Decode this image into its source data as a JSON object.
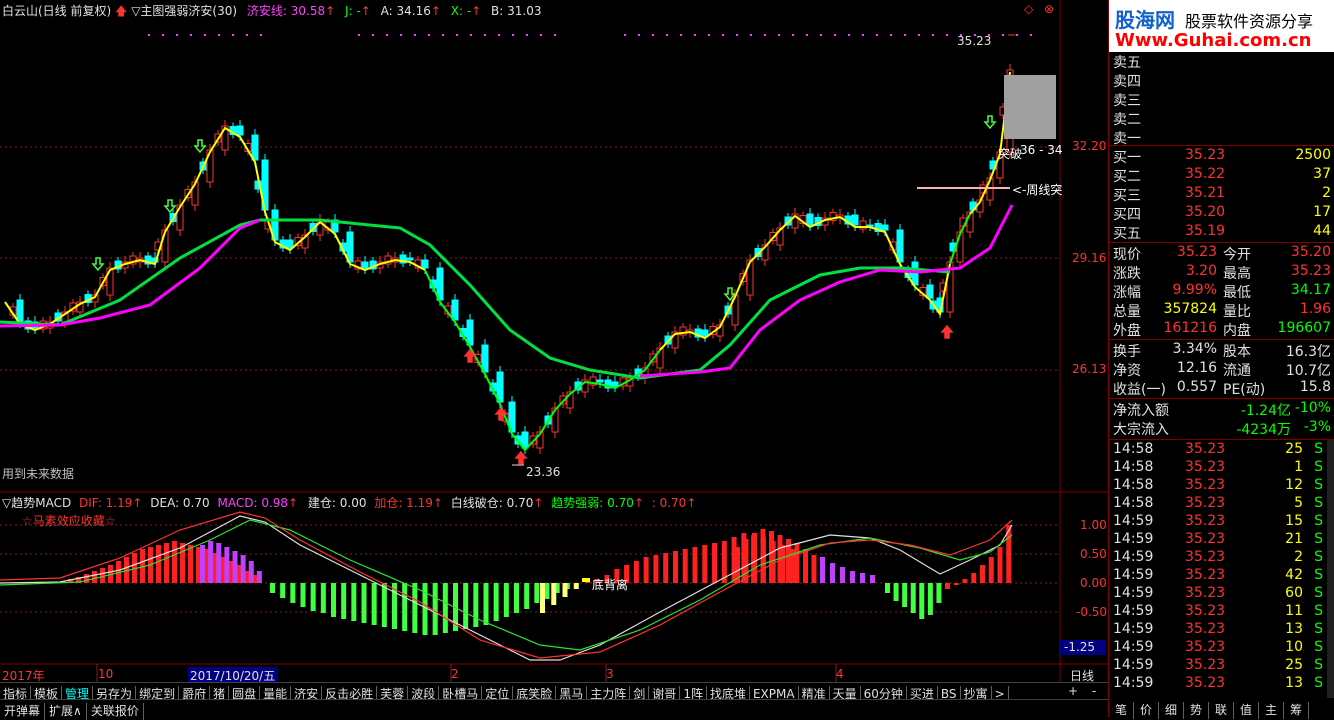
{
  "header": {
    "stock": "白云山(日线 前复权)",
    "indicator": "▽主图强弱济安(30)",
    "jian": "济安线: 30.58",
    "j": "J: -",
    "a": "A: 34.16",
    "x": "X: -",
    "b": "B: 31.03"
  },
  "main_chart": {
    "price_labels": [
      "32.20",
      "29.16",
      "26.13"
    ],
    "high_label": "35.23",
    "low_label": "23.36",
    "annot_breakout": "突破",
    "annot_range": "36 - 34",
    "annot_week": "<-周线突",
    "future_note": "用到未来数据"
  },
  "macd": {
    "title": "▽趋势MACD",
    "dif": "DIF: 1.19",
    "dea": "DEA: 0.70",
    "macd": "MACD: 0.98",
    "jc": "建仓: 0.00",
    "jia": "加仓: 1.19",
    "bai": "白线破仓: 0.70",
    "qs": "趋势强弱: 0.70",
    "colon": ": 0.70",
    "subtitle": "☆马素效应收藏☆",
    "levels": [
      "1.00",
      "0.50",
      "0.00",
      "-0.50"
    ],
    "cursor_value": "-1.25",
    "divergence": "底背离"
  },
  "time_axis": {
    "labels": [
      "2017年",
      "10",
      "2017/10/20/五",
      "2",
      "3",
      "4"
    ],
    "period": "日线"
  },
  "toolbar": {
    "buttons": [
      "指标",
      "模板",
      "管理",
      "另存为",
      "绑定到",
      "爵府",
      "猪",
      "圆盘",
      "量能",
      "济安",
      "反击必胜",
      "芙蓉",
      "波段",
      "卧槽马",
      "定位",
      "底笑脸",
      "黑马",
      "主力阵",
      "剑",
      "谢哥",
      "1阵",
      "找底堆",
      "EXPMA",
      "精准",
      "天量",
      "60分钟",
      "买进",
      "BS",
      "抄寓"
    ],
    "more": ">",
    "plus": "+",
    "minus": "-"
  },
  "bottom": {
    "items": [
      "开弹幕",
      "扩展∧",
      "关联报价"
    ]
  },
  "side": {
    "brand_name": "股海网",
    "brand_slogan": "股票软件资源分享",
    "brand_url": "Www.Guhai.com.cn",
    "sell": [
      {
        "label": "卖五"
      },
      {
        "label": "卖四"
      },
      {
        "label": "卖三"
      },
      {
        "label": "卖二"
      },
      {
        "label": "卖一"
      }
    ],
    "buy": [
      {
        "label": "买一",
        "price": "35.23",
        "vol": "2500"
      },
      {
        "label": "买二",
        "price": "35.22",
        "vol": "37"
      },
      {
        "label": "买三",
        "price": "35.21",
        "vol": "2"
      },
      {
        "label": "买四",
        "price": "35.20",
        "vol": "17"
      },
      {
        "label": "买五",
        "price": "35.19",
        "vol": "44"
      }
    ],
    "stats1": [
      {
        "l1": "现价",
        "v1": "35.23",
        "l2": "今开",
        "v2": "35.20"
      },
      {
        "l1": "涨跌",
        "v1": "3.20",
        "l2": "最高",
        "v2": "35.23"
      },
      {
        "l1": "涨幅",
        "v1": "9.99%",
        "l2": "最低",
        "v2": "34.17"
      },
      {
        "l1": "总量",
        "v1": "357824",
        "l2": "量比",
        "v2": "1.96"
      },
      {
        "l1": "外盘",
        "v1": "161216",
        "l2": "内盘",
        "v2": "196607"
      }
    ],
    "stats2": [
      {
        "l1": "换手",
        "v1": "3.34%",
        "l2": "股本",
        "v2": "16.3亿"
      },
      {
        "l1": "净资",
        "v1": "12.16",
        "l2": "流通",
        "v2": "10.7亿"
      },
      {
        "l1": "收益(一)",
        "v1": "0.557",
        "l2": "PE(动)",
        "v2": "15.8"
      }
    ],
    "flow": [
      {
        "label": "净流入额",
        "v1": "-1.24亿",
        "v2": "-10%"
      },
      {
        "label": "大宗流入",
        "v1": "-4234万",
        "v2": "-3%"
      }
    ],
    "ticks": [
      {
        "t": "14:58",
        "p": "35.23",
        "v": "25",
        "d": "S"
      },
      {
        "t": "14:58",
        "p": "35.23",
        "v": "1",
        "d": "S"
      },
      {
        "t": "14:58",
        "p": "35.23",
        "v": "12",
        "d": "S"
      },
      {
        "t": "14:58",
        "p": "35.23",
        "v": "5",
        "d": "S"
      },
      {
        "t": "14:59",
        "p": "35.23",
        "v": "15",
        "d": "S"
      },
      {
        "t": "14:59",
        "p": "35.23",
        "v": "21",
        "d": "S"
      },
      {
        "t": "14:59",
        "p": "35.23",
        "v": "2",
        "d": "S"
      },
      {
        "t": "14:59",
        "p": "35.23",
        "v": "42",
        "d": "S"
      },
      {
        "t": "14:59",
        "p": "35.23",
        "v": "60",
        "d": "S"
      },
      {
        "t": "14:59",
        "p": "35.23",
        "v": "11",
        "d": "S"
      },
      {
        "t": "14:59",
        "p": "35.23",
        "v": "13",
        "d": "S"
      },
      {
        "t": "14:59",
        "p": "35.23",
        "v": "10",
        "d": "S"
      },
      {
        "t": "14:59",
        "p": "35.23",
        "v": "25",
        "d": "S"
      },
      {
        "t": "14:59",
        "p": "35.23",
        "v": "13",
        "d": "S"
      }
    ],
    "tabs": [
      "笔",
      "价",
      "细",
      "势",
      "联",
      "值",
      "主",
      "筹"
    ]
  },
  "colors": {
    "up": "#ff3232",
    "down": "#00ffff",
    "yellow": "#ffff00",
    "green": "#00ff00",
    "magenta": "#ff00ff",
    "purple": "#b040ff"
  }
}
